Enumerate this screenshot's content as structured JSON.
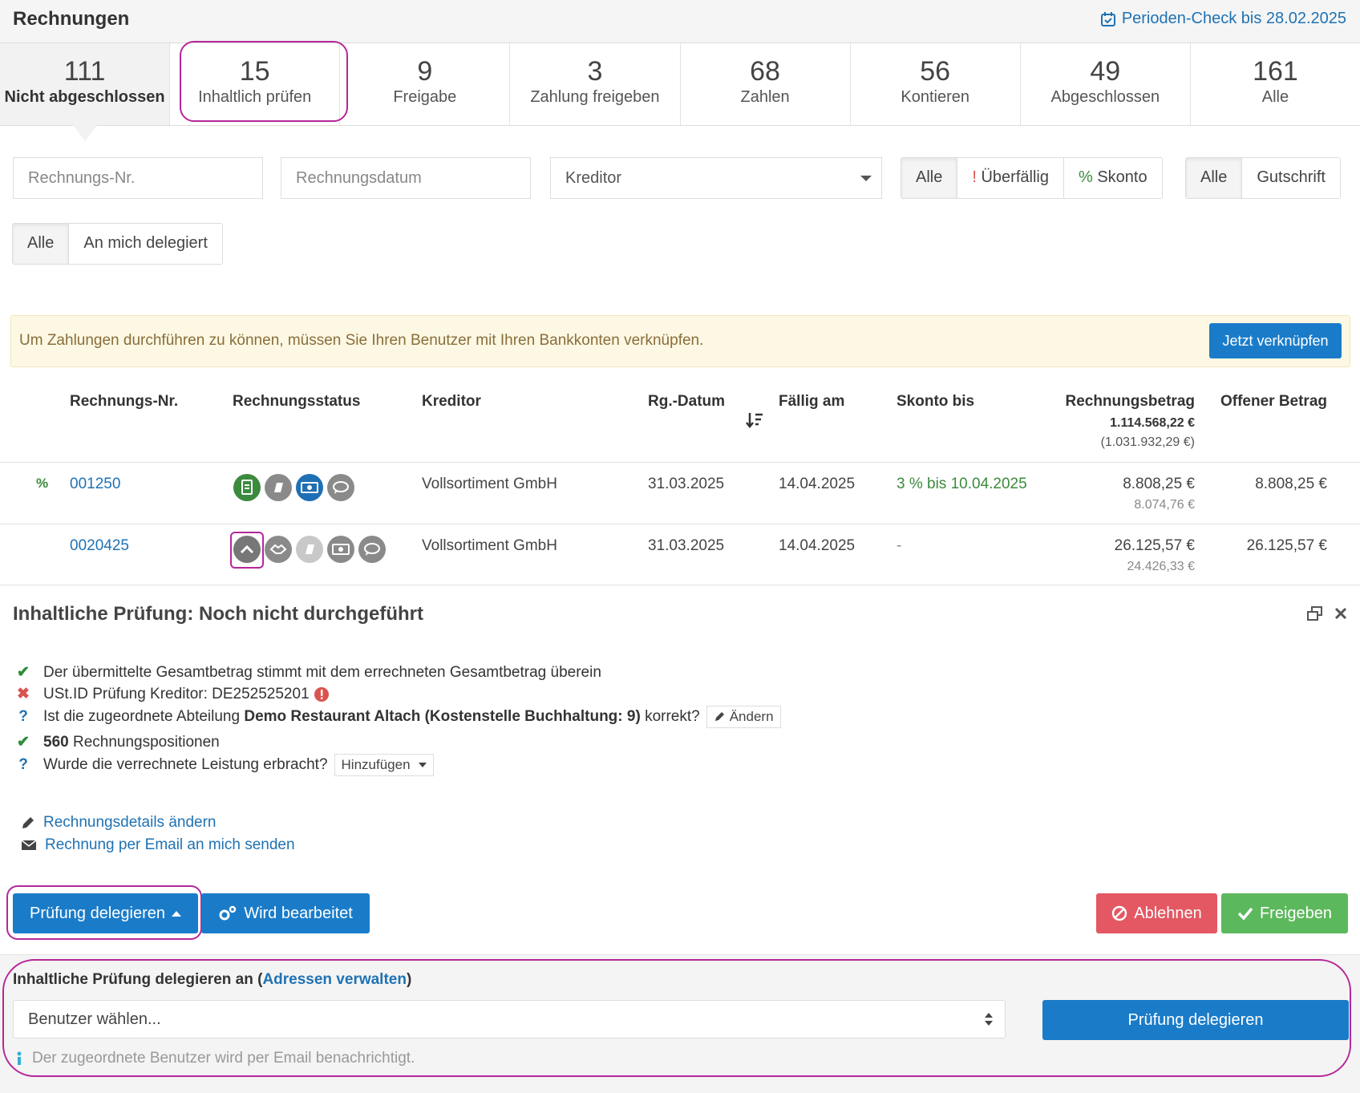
{
  "header": {
    "title": "Rechnungen",
    "period_check": "Perioden-Check bis 28.02.2025"
  },
  "tabs": [
    {
      "count": "111",
      "label": "Nicht abgeschlossen"
    },
    {
      "count": "15",
      "label": "Inhaltlich prüfen"
    },
    {
      "count": "9",
      "label": "Freigabe"
    },
    {
      "count": "3",
      "label": "Zahlung freigeben"
    },
    {
      "count": "68",
      "label": "Zahlen"
    },
    {
      "count": "56",
      "label": "Kontieren"
    },
    {
      "count": "49",
      "label": "Abgeschlossen"
    },
    {
      "count": "161",
      "label": "Alle"
    }
  ],
  "filters": {
    "invoice_no_placeholder": "Rechnungs-Nr.",
    "invoice_date_placeholder": "Rechnungsdatum",
    "creditor_select": "Kreditor",
    "status_group": {
      "all": "Alle",
      "overdue_mark": "!",
      "overdue": "Überfällig",
      "discount_mark": "%",
      "discount": "Skonto"
    },
    "type_group": {
      "all": "Alle",
      "credit": "Gutschrift"
    },
    "delegation_group": {
      "all": "Alle",
      "delegated": "An mich delegiert"
    }
  },
  "alert": {
    "text": "Um Zahlungen durchführen zu können, müssen Sie Ihren Benutzer mit Ihren Bankkonten verknüpfen.",
    "button": "Jetzt verknüpfen"
  },
  "table": {
    "headers": {
      "invoice_no": "Rechnungs-Nr.",
      "status": "Rechnungsstatus",
      "creditor": "Kreditor",
      "date": "Rg.-Datum",
      "due": "Fällig am",
      "discount": "Skonto bis",
      "amount": "Rechnungsbetrag",
      "amount_total": "1.114.568,22 €",
      "amount_net_total": "(1.031.932,29 €)",
      "open": "Offener Betrag"
    },
    "rows": [
      {
        "flag": "%",
        "invoice_no": "001250",
        "creditor": "Vollsortiment GmbH",
        "date": "31.03.2025",
        "due": "14.04.2025",
        "discount": "3 % bis 10.04.2025",
        "amount": "8.808,25 €",
        "amount_net": "8.074,76 €",
        "open": "8.808,25 €"
      },
      {
        "flag": "",
        "invoice_no": "0020425",
        "creditor": "Vollsortiment GmbH",
        "date": "31.03.2025",
        "due": "14.04.2025",
        "discount": "-",
        "amount": "26.125,57 €",
        "amount_net": "24.426,33 €",
        "open": "26.125,57 €"
      }
    ]
  },
  "panel": {
    "title": "Inhaltliche Prüfung: Noch nicht durchgeführt",
    "checks": {
      "c1": "Der übermittelte Gesamtbetrag stimmt mit dem errechneten Gesamtbetrag überein",
      "c2": "USt.ID Prüfung Kreditor: DE252525201",
      "c3_pre": "Ist die zugeordnete Abteilung",
      "c3_bold": "Demo Restaurant Altach (Kostenstelle Buchhaltung: 9)",
      "c3_post": "korrekt?",
      "c3_btn": "Ändern",
      "c4_bold": "560",
      "c4": "Rechnungspositionen",
      "c5": "Wurde die verrechnete Leistung erbracht?",
      "c5_btn": "Hinzufügen"
    },
    "links": {
      "edit": "Rechnungsdetails ändern",
      "email": "Rechnung per Email an mich senden"
    },
    "buttons": {
      "delegate": "Prüfung delegieren",
      "in_progress": "Wird bearbeitet",
      "reject": "Ablehnen",
      "approve": "Freigeben"
    }
  },
  "delegation": {
    "title": "Inhaltliche Prüfung delegieren an (",
    "manage_link": "Adressen verwalten",
    "title_end": ")",
    "select_placeholder": "Benutzer wählen...",
    "button": "Prüfung delegieren",
    "info": "Der zugeordnete Benutzer wird per Email benachrichtigt."
  },
  "colors": {
    "primary": "#1a7cc9",
    "danger": "#e35862",
    "success": "#5cb85c",
    "highlight": "#b5279a",
    "alert_bg": "#fcf8e3"
  }
}
